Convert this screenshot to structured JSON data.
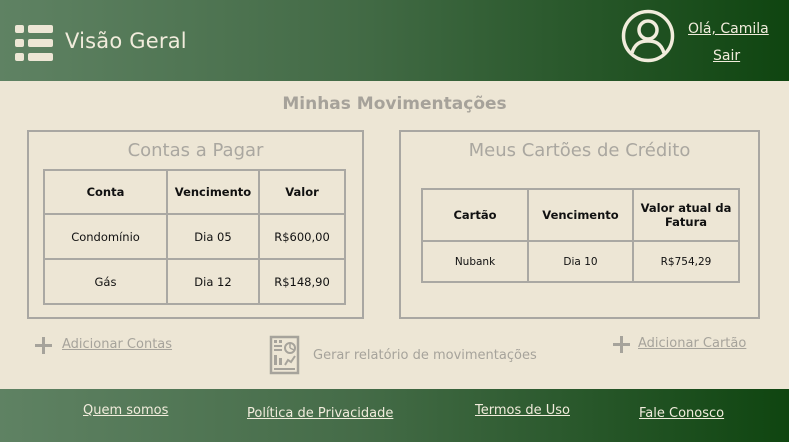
{
  "header": {
    "title": "Visão Geral",
    "greeting": "Olá, Camila",
    "logout": "Sair",
    "menu_icon": "hamburger-list-icon",
    "avatar_icon": "user-avatar-icon"
  },
  "main": {
    "section_title": "Minhas Movimentações",
    "bills": {
      "title": "Contas a Pagar",
      "columns": [
        "Conta",
        "Vencimento",
        "Valor"
      ],
      "rows": [
        [
          "Condomínio",
          "Dia 05",
          "R$600,00"
        ],
        [
          "Gás",
          "Dia 12",
          "R$148,90"
        ]
      ]
    },
    "cards": {
      "title": "Meus Cartões de Crédito",
      "columns": [
        "Cartão",
        "Vencimento",
        "Valor atual da Fatura"
      ],
      "rows": [
        [
          "Nubank",
          "Dia 10",
          "R$754,29"
        ]
      ]
    },
    "actions": {
      "add_bills": "Adicionar Contas",
      "report": "Gerar relatório de movimentações",
      "add_card": "Adicionar Cartão"
    }
  },
  "footer": {
    "links": [
      "Quem somos",
      "Política de Privacidade",
      "Termos de Uso",
      "Fale Conosco"
    ]
  },
  "colors": {
    "header_start": "#5f8263",
    "header_end": "#0f4510",
    "background": "#ede6d5",
    "muted_text": "#a6a39b"
  }
}
